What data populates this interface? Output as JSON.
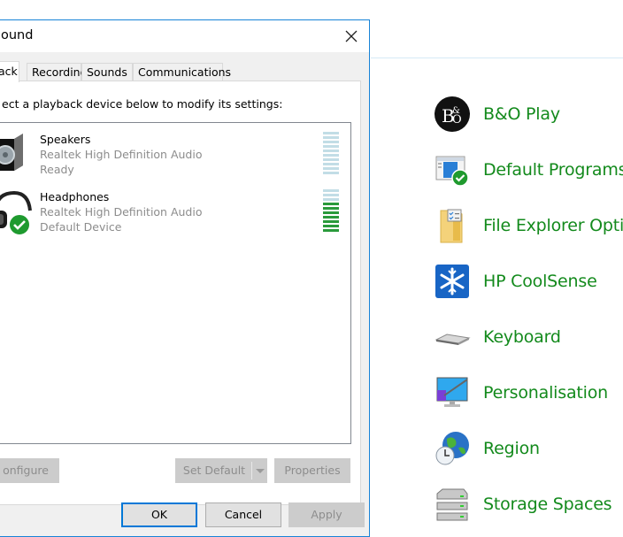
{
  "dialog": {
    "title": "Sound",
    "title_visible": "ound",
    "close_label": "Close",
    "tabs": [
      {
        "label": "Playback",
        "visible": "ack",
        "active": true
      },
      {
        "label": "Recording",
        "active": false
      },
      {
        "label": "Sounds",
        "active": false
      },
      {
        "label": "Communications",
        "active": false
      }
    ],
    "instruction": "Select a playback device below to modify its settings:",
    "instruction_visible": "ect a playback device below to modify its settings:",
    "devices": [
      {
        "name": "Speakers",
        "driver": "Realtek High Definition Audio",
        "status": "Ready",
        "icon": "speaker-icon",
        "is_default": false,
        "level_segments_total": 10,
        "level_segments_active": 0
      },
      {
        "name": "Headphones",
        "driver": "Realtek High Definition Audio",
        "status": "Default Device",
        "icon": "headphones-icon",
        "is_default": true,
        "level_segments_total": 10,
        "level_segments_active": 7
      }
    ],
    "buttons": {
      "configure": "Configure",
      "configure_visible": "onfigure",
      "set_default": "Set Default",
      "properties": "Properties",
      "ok": "OK",
      "cancel": "Cancel",
      "apply": "Apply"
    },
    "colors": {
      "accent": "#0078d7",
      "meter_on": "#2a9a3b",
      "meter_off": "#c2dde6"
    }
  },
  "control_panel": {
    "link_color": "#138a1c",
    "items": [
      {
        "label": "B&O Play",
        "icon": "bo-play-icon"
      },
      {
        "label": "Default Programs",
        "icon": "default-programs-icon"
      },
      {
        "label": "File Explorer Options",
        "visible": "File Explorer Optio",
        "icon": "file-explorer-options-icon"
      },
      {
        "label": "HP CoolSense",
        "icon": "snowflake-icon"
      },
      {
        "label": "Keyboard",
        "icon": "keyboard-icon"
      },
      {
        "label": "Personalisation",
        "icon": "personalisation-icon"
      },
      {
        "label": "Region",
        "icon": "region-globe-icon"
      },
      {
        "label": "Storage Spaces",
        "icon": "storage-spaces-icon"
      }
    ]
  }
}
